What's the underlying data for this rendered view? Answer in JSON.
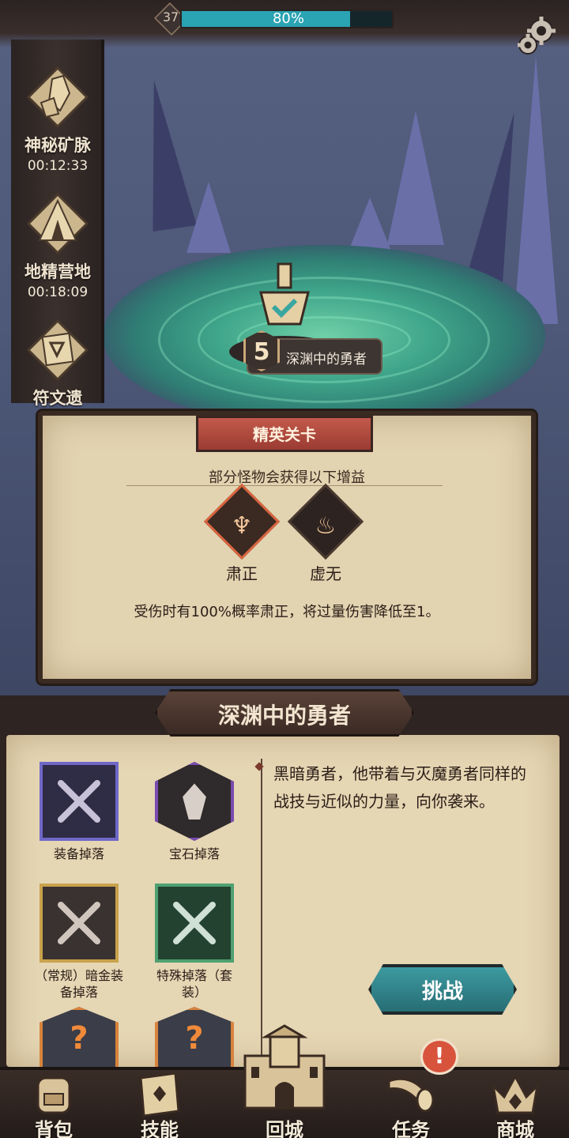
{
  "hud": {
    "level": "37",
    "xp_percent": 80,
    "xp_text": "80%",
    "icon": "gear-icon"
  },
  "sidebar": {
    "items": [
      {
        "label": "神秘矿脉",
        "timer": "00:12:33",
        "icon": "crystal-mine-icon"
      },
      {
        "label": "地精营地",
        "timer": "00:18:09",
        "icon": "goblin-tent-icon"
      },
      {
        "label": "符文遗",
        "timer": "",
        "icon": "rune-ruin-icon"
      }
    ]
  },
  "stage": {
    "number": "5",
    "name": "深渊中的勇者"
  },
  "elite": {
    "banner": "精英关卡",
    "subtitle": "部分怪物会获得以下增益",
    "buffs": [
      {
        "label": "肃正",
        "icon": "trident-icon"
      },
      {
        "label": "虚无",
        "icon": "void-flame-icon"
      }
    ],
    "description": "受伤时有100%概率肃正，将过量伤害降低至1。"
  },
  "main": {
    "title": "深渊中的勇者",
    "drops": [
      {
        "label": "装备掉落",
        "icon": "crossed-swords-icon"
      },
      {
        "label": "宝石掉落",
        "icon": "gem-icon"
      },
      {
        "label": "（常规）暗金装备掉落",
        "icon": "crossed-swords-icon"
      },
      {
        "label": "特殊掉落（套装）",
        "icon": "crossed-swords-icon"
      },
      {
        "label": "",
        "icon": "mystery-icon"
      },
      {
        "label": "",
        "icon": "mystery-icon"
      }
    ],
    "description": "黑暗勇者，他带着与灭魔勇者同样的战技与近似的力量，向你袭来。",
    "challenge_label": "挑战"
  },
  "nav": {
    "items": [
      {
        "label": "背包",
        "icon": "backpack-icon"
      },
      {
        "label": "技能",
        "icon": "skill-book-icon"
      },
      {
        "label": "回城",
        "icon": "castle-icon"
      },
      {
        "label": "任务",
        "icon": "horn-icon"
      },
      {
        "label": "商城",
        "icon": "crown-shop-icon"
      }
    ],
    "alert": "!"
  },
  "colors": {
    "accent_teal": "#2aa3b3",
    "elite_red": "#b04a3e",
    "parchment": "#e2d3b1",
    "frame_dark": "#2e2421"
  }
}
